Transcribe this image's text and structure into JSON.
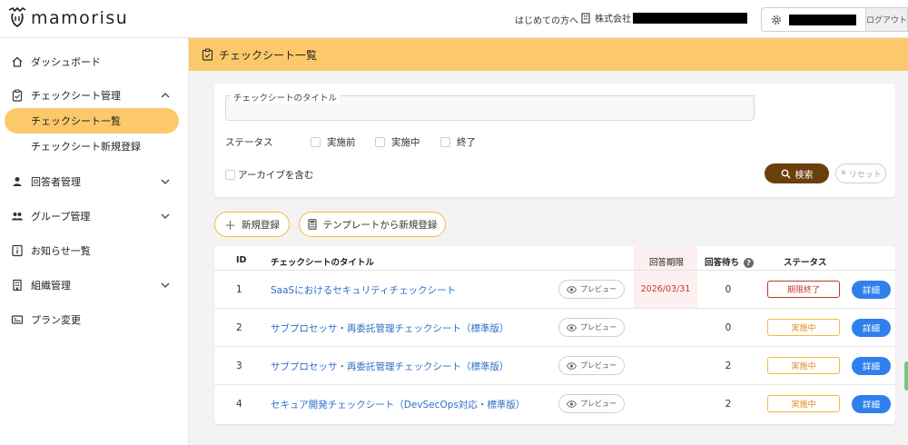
{
  "header": {
    "logo_text": "mamorisu",
    "first_time_link": "はじめての方へ",
    "company_label": "株式会社",
    "logout_label": "ログアウト"
  },
  "sidebar": {
    "items": [
      {
        "label": "ダッシュボード",
        "icon": "home-icon"
      },
      {
        "label": "チェックシート管理",
        "icon": "clipboard-icon",
        "expanded": true,
        "children": [
          {
            "label": "チェックシート一覧",
            "active": true
          },
          {
            "label": "チェックシート新規登録",
            "active": false
          }
        ]
      },
      {
        "label": "回答者管理",
        "icon": "person-icon"
      },
      {
        "label": "グループ管理",
        "icon": "group-icon"
      },
      {
        "label": "お知らせ一覧",
        "icon": "info-icon"
      },
      {
        "label": "組織管理",
        "icon": "building-icon"
      },
      {
        "label": "プラン変更",
        "icon": "card-icon"
      }
    ]
  },
  "page": {
    "title": "チェックシート一覧"
  },
  "search": {
    "title_label": "チェックシートのタイトル",
    "title_value": "",
    "status_label": "ステータス",
    "status_options": [
      "実施前",
      "実施中",
      "終了"
    ],
    "archive_label": "アーカイブを含む",
    "search_button": "検索",
    "reset_button": "リセット"
  },
  "actions": {
    "new_button": "新規登録",
    "template_button": "テンプレートから新規登録"
  },
  "table": {
    "headers": {
      "id": "ID",
      "title": "チェックシートのタイトル",
      "deadline": "回答期限",
      "waiting": "回答待ち",
      "status": "ステータス"
    },
    "preview_label": "プレビュー",
    "detail_label": "詳細",
    "rows": [
      {
        "id": "1",
        "title": "SaaSにおけるセキュリティチェックシート",
        "deadline": "2026/03/31",
        "waiting": "0",
        "status": "期限終了",
        "status_kind": "ended"
      },
      {
        "id": "2",
        "title": "サブプロセッサ・再委託管理チェックシート（標準版）",
        "deadline": "",
        "waiting": "0",
        "status": "実施中",
        "status_kind": "active"
      },
      {
        "id": "3",
        "title": "サブプロセッサ・再委託管理チェックシート（標準版）",
        "deadline": "",
        "waiting": "2",
        "status": "実施中",
        "status_kind": "active"
      },
      {
        "id": "4",
        "title": "セキュア開発チェックシート（DevSecOps対応・標準版）",
        "deadline": "",
        "waiting": "2",
        "status": "実施中",
        "status_kind": "active"
      }
    ]
  },
  "colors": {
    "accent": "#fcc96a",
    "search_button": "#6b3f0c",
    "detail_button": "#2f80ed",
    "link": "#2b6fc9",
    "ended": "#c0392b"
  }
}
